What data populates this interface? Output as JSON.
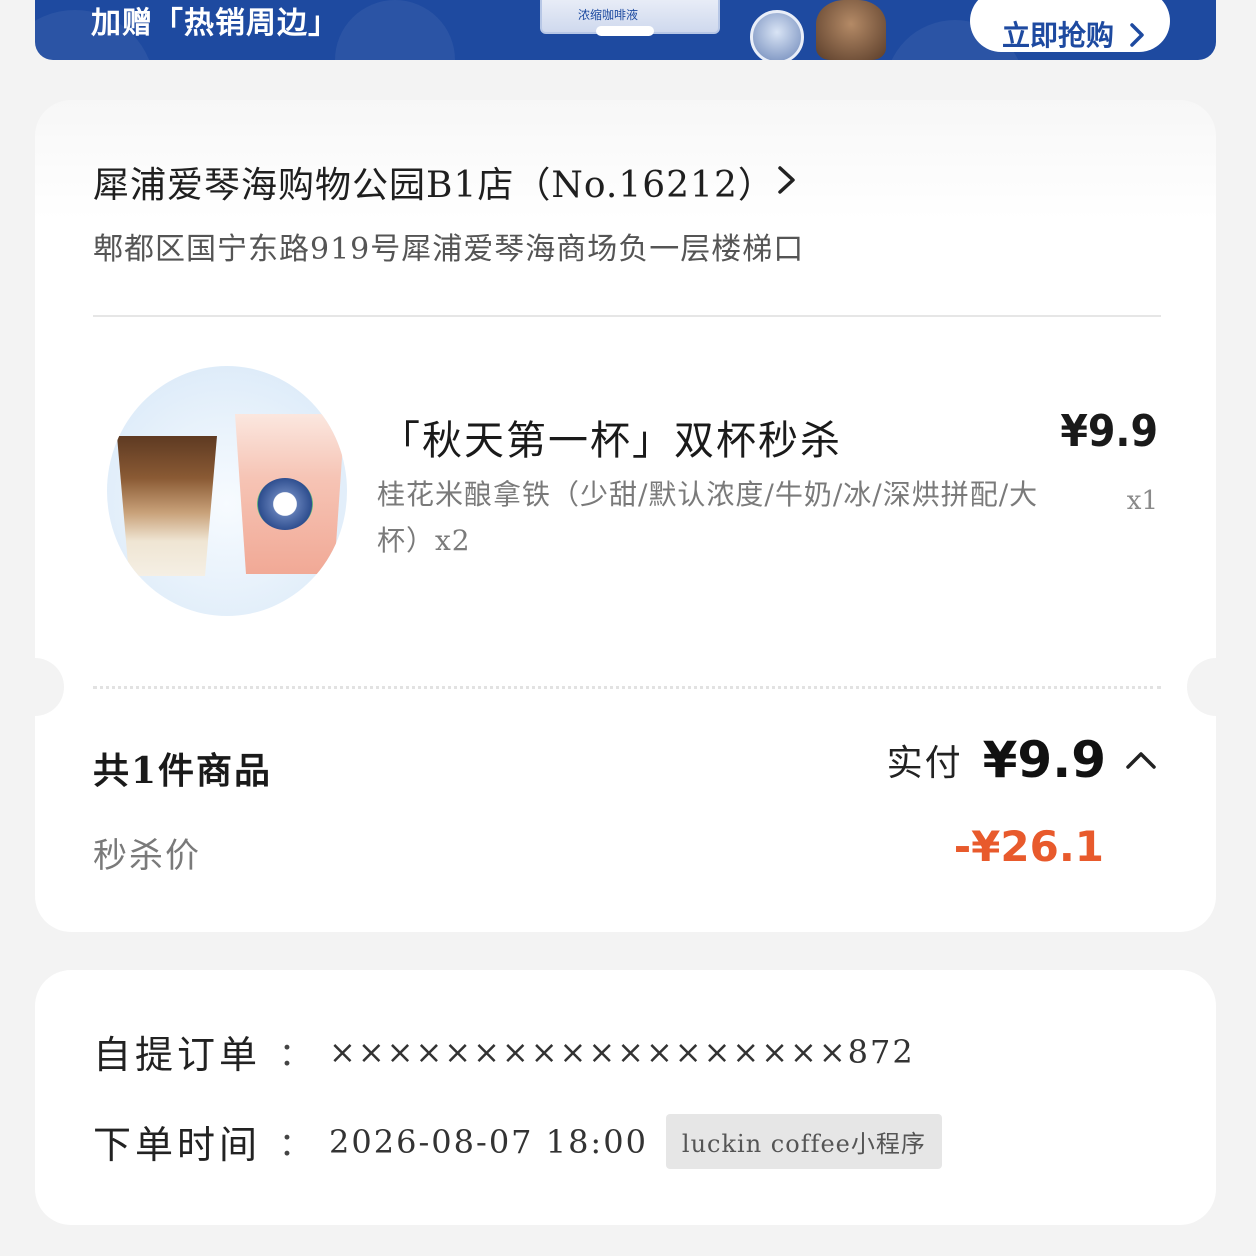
{
  "banner": {
    "text": "加赠「热销周边」",
    "product_label": "浓缩咖啡液",
    "button_label": "立即抢购"
  },
  "store": {
    "name": "犀浦爱琴海购物公园B1店（No.16212）",
    "address": "郫都区国宁东路919号犀浦爱琴海商场负一层楼梯口"
  },
  "product": {
    "title": "「秋天第一杯」双杯秒杀",
    "price": "¥9.9",
    "spec": "桂花米酿拿铁（少甜/默认浓度/牛奶/冰/深烘拼配/大杯）x2",
    "qty": "x1"
  },
  "summary": {
    "count_label": "共1件商品",
    "paid_label": "实付",
    "paid_amount": "¥9.9",
    "discount_label": "秒杀价",
    "discount_amount": "-¥26.1"
  },
  "order_info": {
    "order_label": "自提订单",
    "colon": "：",
    "order_number": "××××××××××××××××××872",
    "time_label": "下单时间",
    "time_value": "2026-08-07 18:00",
    "source": "luckin coffee小程序"
  },
  "colors": {
    "banner_blue": "#1e4aa0",
    "discount_orange": "#e85a2c",
    "page_bg": "#f3f3f3"
  }
}
